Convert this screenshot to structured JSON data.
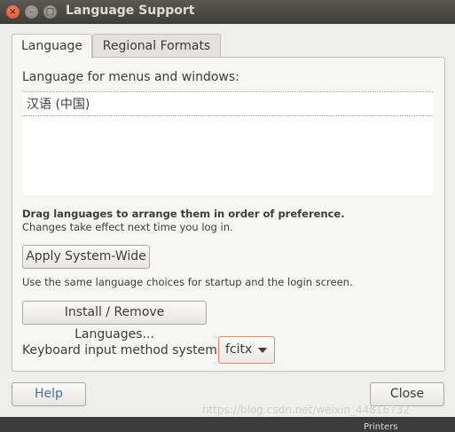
{
  "window": {
    "title": "Language Support",
    "close_glyph": "×",
    "min_glyph": "–",
    "max_glyph": "□"
  },
  "tabs": [
    {
      "label": "Language",
      "active": true
    },
    {
      "label": "Regional Formats",
      "active": false
    }
  ],
  "language_tab": {
    "section_label": "Language for menus and windows:",
    "languages": [
      "汉语 (中国)"
    ],
    "drag_hint": "Drag languages to arrange them in order of preference.",
    "effect_hint": "Changes take effect next time you log in.",
    "apply_button": "Apply System-Wide",
    "same_hint": "Use the same language choices for startup and the login screen.",
    "install_button": "Install / Remove Languages...",
    "keyboard_label": "Keyboard input method system:",
    "keyboard_value": "fcitx"
  },
  "footer": {
    "help_button": "Help",
    "close_button": "Close"
  },
  "watermark": "https://blog.csdn.net/weixin_44816732",
  "background_text": "Printers",
  "colors": {
    "title_bar": "#3e3d39",
    "accent": "#e2856a",
    "help_text": "#4a6fa5"
  }
}
